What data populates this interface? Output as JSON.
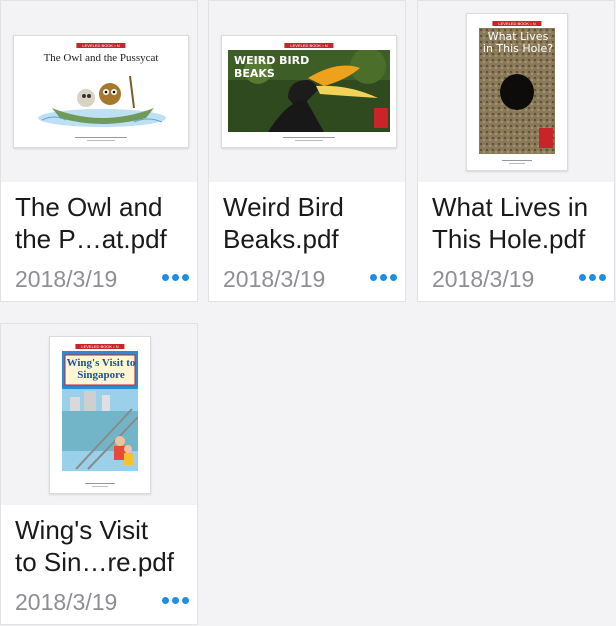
{
  "files": [
    {
      "title_line1": "The Owl and",
      "title_line2": "the P…at.pdf",
      "date": "2018/3/19",
      "cover": {
        "series": "LEVELED BOOK • N",
        "heading": "The Owl and the Pussycat"
      }
    },
    {
      "title_line1": "Weird Bird",
      "title_line2": "Beaks.pdf",
      "date": "2018/3/19",
      "cover": {
        "series": "LEVELED BOOK • N",
        "heading": "WEIRD BIRD BEAKS"
      }
    },
    {
      "title_line1": "What Lives in",
      "title_line2": "This Hole.pdf",
      "date": "2018/3/19",
      "cover": {
        "series": "LEVELED BOOK • N",
        "heading": "What Lives in This Hole?"
      }
    },
    {
      "title_line1": "Wing's Visit",
      "title_line2": "to Sin…re.pdf",
      "date": "2018/3/19",
      "cover": {
        "series": "LEVELED BOOK • N",
        "heading": "Wing's Visit to Singapore"
      }
    }
  ],
  "colors": {
    "accent": "#1e8de6",
    "date_text": "#8e8e93",
    "background": "#f3f3f5"
  },
  "icons": {
    "more": "more-horizontal-icon"
  }
}
